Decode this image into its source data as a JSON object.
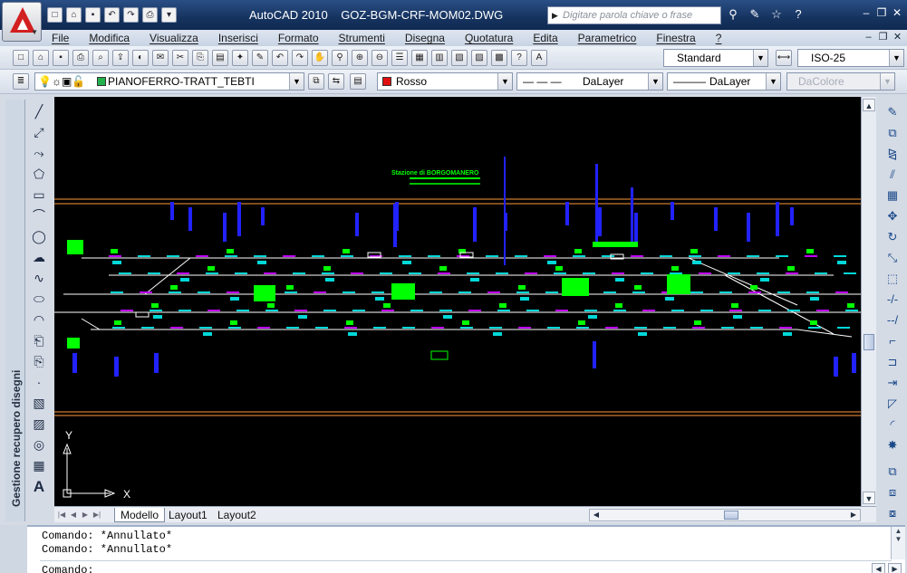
{
  "titlebar": {
    "app_name": "AutoCAD 2010",
    "file_name": "GOZ-BGM-CRF-MOM02.DWG",
    "search_placeholder": "Digitare parola chiave o frase"
  },
  "menu": {
    "items": [
      "File",
      "Modifica",
      "Visualizza",
      "Inserisci",
      "Formato",
      "Strumenti",
      "Disegna",
      "Quotatura",
      "Edita",
      "Parametrico",
      "Finestra",
      "?"
    ]
  },
  "styles_toolbar": {
    "text_style": "Standard",
    "dim_style": "ISO-25"
  },
  "layers_toolbar": {
    "current_layer": "PIANOFERRO-TRATT_TEBTI",
    "layer_color": "#22b14c",
    "color_value": "Rosso",
    "color_swatch": "#e01010",
    "linetype": "DaLayer",
    "lineweight": "DaLayer",
    "plot_style": "DaColore"
  },
  "palette": {
    "title": "Gestione recupero disegni"
  },
  "drawing": {
    "title_text": "Stazione di BORGOMANERO",
    "ucs_x": "X",
    "ucs_y": "Y",
    "colors": {
      "background": "#000000",
      "track": "#ffffff",
      "boundary": "#ff9a3a",
      "blue": "#2222ff",
      "cyan": "#00d8d8",
      "green": "#00ff00",
      "magenta": "#c000ff"
    }
  },
  "layout_tabs": [
    "Modello",
    "Layout1",
    "Layout2"
  ],
  "command_line": {
    "history": [
      "Comando: *Annullato*",
      "Comando: *Annullato*"
    ],
    "prompt": "Comando:"
  }
}
